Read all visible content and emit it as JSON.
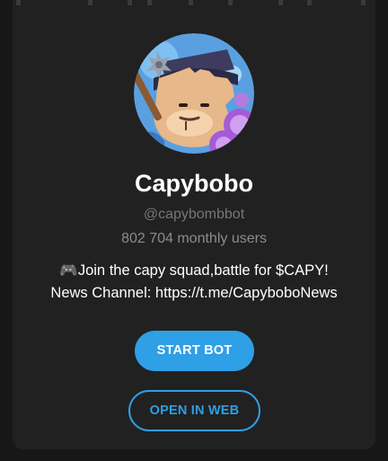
{
  "bot": {
    "name": "Capybobo",
    "username": "@capybombbot",
    "monthly_users": "802 704 monthly users",
    "description_line1": "🎮Join the capy squad,battle for $CAPY!",
    "description_line2": "News Channel: https://t.me/CapyboboNews"
  },
  "actions": {
    "start_label": "START BOT",
    "web_label": "OPEN IN WEB"
  },
  "colors": {
    "background": "#171717",
    "card": "#212121",
    "accent": "#2f9fe6",
    "muted_text": "#8c8c8c"
  }
}
